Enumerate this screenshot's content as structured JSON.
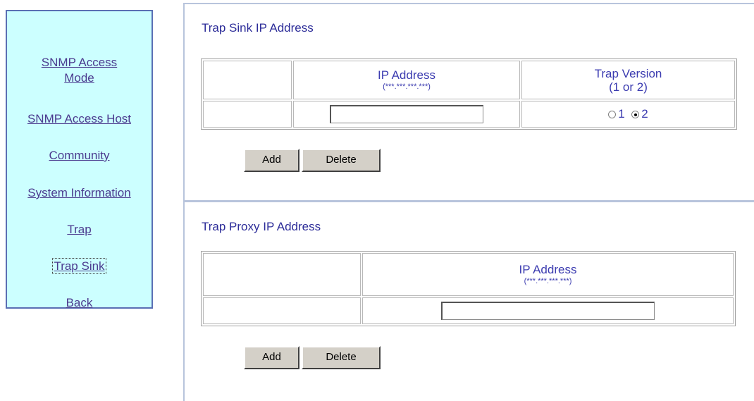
{
  "nav": {
    "items": [
      {
        "label_line1": "SNMP Access",
        "label_line2": "Mode"
      },
      {
        "label": "SNMP Access Host"
      },
      {
        "label": "Community"
      },
      {
        "label": "System Information"
      },
      {
        "label": "Trap"
      },
      {
        "label": "Trap Sink"
      },
      {
        "label": "Back"
      }
    ]
  },
  "trap_sink": {
    "title": "Trap Sink IP Address",
    "col_ip": "IP Address",
    "col_ip_format": "(***.***.***.***)",
    "col_version_line1": "Trap Version",
    "col_version_line2": "(1 or 2)",
    "ip_value": "",
    "version_option1": "1",
    "version_option2": "2",
    "selected_version": "2",
    "add_label": "Add",
    "delete_label": "Delete"
  },
  "trap_proxy": {
    "title": "Trap Proxy IP Address",
    "col_ip": "IP Address",
    "col_ip_format": "(***.***.***.***)",
    "ip_value": "",
    "add_label": "Add",
    "delete_label": "Delete"
  }
}
